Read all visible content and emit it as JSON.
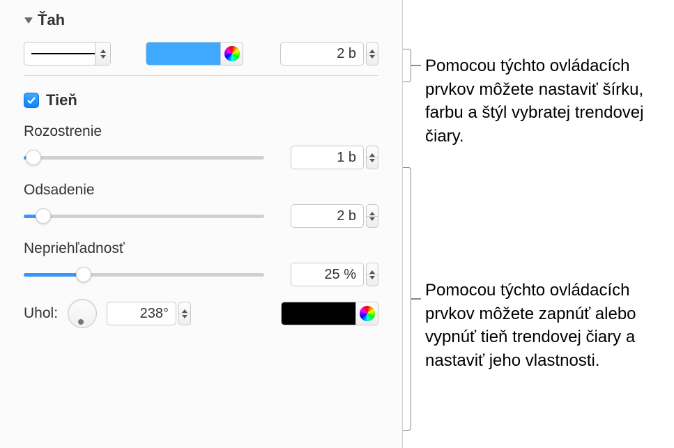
{
  "stroke": {
    "section_label": "Ťah",
    "width_value": "2 b",
    "color": "#3fa9ff"
  },
  "shadow": {
    "section_label": "Tieň",
    "checked": true,
    "blur": {
      "label": "Rozostrenie",
      "value_text": "1 b",
      "percent": 4
    },
    "offset": {
      "label": "Odsadenie",
      "value_text": "2 b",
      "percent": 8
    },
    "opacity": {
      "label": "Nepriehľadnosť",
      "value_text": "25 %",
      "percent": 25
    },
    "angle": {
      "label": "Uhol:",
      "value_text": "238°",
      "degrees": 238
    },
    "color": "#000000"
  },
  "callouts": {
    "stroke_note": "Pomocou týchto ovládacích prvkov môžete nastaviť šírku, farbu a štýl vybratej trendovej čiary.",
    "shadow_note": "Pomocou týchto ovládacích prvkov môžete zapnúť alebo vypnúť tieň trendovej čiary a nastaviť jeho vlastnosti."
  }
}
